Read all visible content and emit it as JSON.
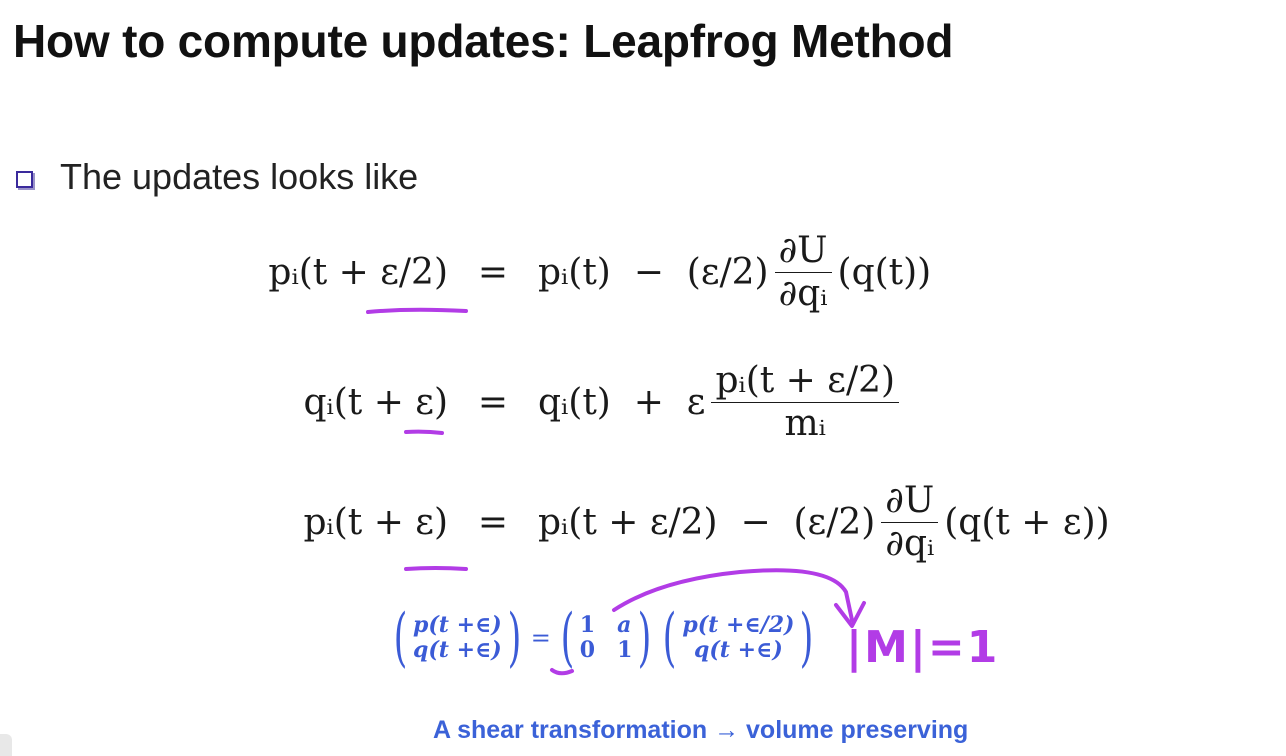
{
  "slide": {
    "title": "How to compute updates: Leapfrog Method",
    "bullet": "The updates looks like"
  },
  "equations": [
    {
      "lhs": "pᵢ(t + ε/2)",
      "rhs_a": "pᵢ(t)  −  (ε/2)",
      "frac_num": "∂U",
      "frac_den": "∂qᵢ",
      "rhs_b": "(q(t))"
    },
    {
      "lhs": "qᵢ(t + ε)",
      "rhs_a": "qᵢ(t)  +  ε",
      "frac_num": "pᵢ(t + ε/2)",
      "frac_den": "mᵢ",
      "rhs_b": ""
    },
    {
      "lhs": "pᵢ(t + ε)",
      "rhs_a": "pᵢ(t + ε/2)  −  (ε/2)",
      "frac_num": "∂U",
      "frac_den": "∂qᵢ",
      "rhs_b": "(q(t + ε))"
    }
  ],
  "equals_sign": "=",
  "matrix_equation": {
    "lhs_top": "p(t +∈)",
    "lhs_bottom": "q(t +∈)",
    "equals": "=",
    "m11": "1",
    "m12": "a",
    "m21": "0",
    "m22": "1",
    "rhs_top": "p(t +∈/2)",
    "rhs_bottom": "q(t +∈)"
  },
  "handwritten_note": "|M|=1",
  "caption": "A shear transformation  →  volume preserving",
  "colors": {
    "ink_annotation": "#b23ce6",
    "matrix_text": "#3b5bd6",
    "caption_text": "#3b62d8",
    "bullet_box": "#3a2a9c"
  }
}
